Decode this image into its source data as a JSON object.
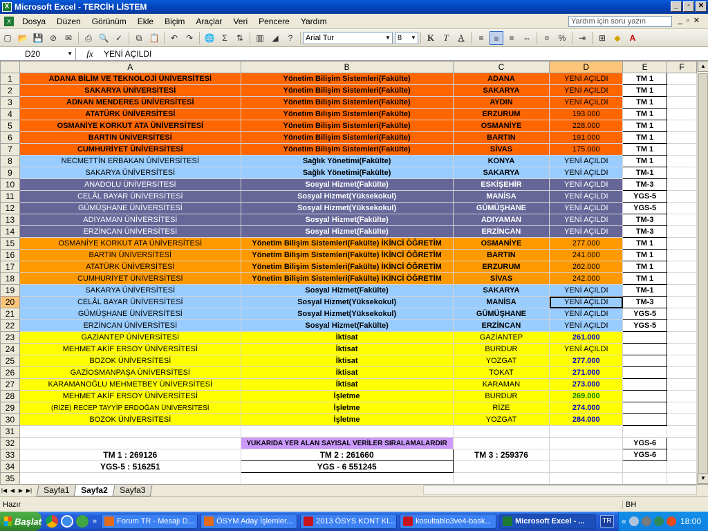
{
  "window": {
    "title": "Microsoft Excel - TERCİH LİSTEM",
    "min": "_",
    "max": "▫",
    "close": "✕"
  },
  "menu": {
    "items": [
      "Dosya",
      "Düzen",
      "Görünüm",
      "Ekle",
      "Biçim",
      "Araçlar",
      "Veri",
      "Pencere",
      "Yardım"
    ],
    "help_placeholder": "Yardım için soru yazın"
  },
  "toolbar": {
    "font": "Arial Tur",
    "size": "8",
    "bold": "K",
    "italic": "T",
    "underline": "A",
    "sum": "Σ",
    "percent": "%"
  },
  "formula": {
    "cell": "D20",
    "fx": "fx",
    "value": "YENİ AÇILDI"
  },
  "columns": [
    "A",
    "B",
    "C",
    "D",
    "E",
    "F"
  ],
  "colors": {
    "orange_red": "#ff6600",
    "orange": "#ff9900",
    "light_blue": "#99ccff",
    "slate": "#666699",
    "yellow": "#ffff00",
    "lavender": "#cc99ff",
    "num_blue": "#0000cc",
    "num_green": "#008000"
  },
  "rows": [
    {
      "n": "1",
      "a": "ADANA BİLİM VE TEKNOLOJİ ÜNİVERSİTESİ",
      "b": "Yönetim Bilişim Sistemleri(Fakülte)",
      "c": "ADANA",
      "d": "YENİ AÇILDI",
      "e": "TM 1",
      "style": "orange_red"
    },
    {
      "n": "2",
      "a": "SAKARYA ÜNİVERSİTESİ",
      "b": "Yönetim Bilişim Sistemleri(Fakülte)",
      "c": "SAKARYA",
      "d": "YENİ AÇILDI",
      "e": "TM 1",
      "style": "orange_red"
    },
    {
      "n": "3",
      "a": "ADNAN MENDERES ÜNİVERSİTESİ",
      "b": "Yönetim Bilişim Sistemleri(Fakülte)",
      "c": "AYDIN",
      "d": "YENİ AÇILDI",
      "e": "TM 1",
      "style": "orange_red"
    },
    {
      "n": "4",
      "a": "ATATÜRK ÜNİVERSİTESİ",
      "b": "Yönetim Bilişim Sistemleri(Fakülte)",
      "c": "ERZURUM",
      "d": "193.000",
      "e": "TM 1",
      "style": "orange_red"
    },
    {
      "n": "5",
      "a": "OSMANİYE KORKUT ATA ÜNİVERSİTESİ",
      "b": "Yönetim Bilişim Sistemleri(Fakülte)",
      "c": "OSMANİYE",
      "d": "228.000",
      "e": "TM 1",
      "style": "orange_red"
    },
    {
      "n": "6",
      "a": "BARTIN ÜNİVERSİTESİ",
      "b": "Yönetim Bilişim Sistemleri(Fakülte)",
      "c": "BARTIN",
      "d": "191.000",
      "e": "TM 1",
      "style": "orange_red"
    },
    {
      "n": "7",
      "a": "CUMHURİYET ÜNİVERSİTESİ",
      "b": "Yönetim Bilişim Sistemleri(Fakülte)",
      "c": "SİVAS",
      "d": "175.000",
      "e": "TM 1",
      "style": "orange_red"
    },
    {
      "n": "8",
      "a": "NECMETTİN ERBAKAN ÜNİVERSİTESİ",
      "b": "Sağlık Yönetimi(Fakülte)",
      "c": "KONYA",
      "d": "YENİ AÇILDI",
      "e": "TM 1",
      "style": "light_blue"
    },
    {
      "n": "9",
      "a": "SAKARYA ÜNİVERSİTESİ",
      "b": "Sağlık Yönetimi(Fakülte)",
      "c": "SAKARYA",
      "d": "YENİ AÇILDI",
      "e": "TM-1",
      "style": "light_blue"
    },
    {
      "n": "10",
      "a": "ANADOLU ÜNİVERSİTESİ",
      "b": "Sosyal Hizmet(Fakülte)",
      "c": "ESKİŞEHİR",
      "d": "YENİ AÇILDI",
      "e": "TM-3",
      "style": "slate"
    },
    {
      "n": "11",
      "a": "CELÂL BAYAR ÜNİVERSİTESİ",
      "b": "Sosyal Hizmet(Yüksekokul)",
      "c": "MANİSA",
      "d": "YENİ AÇILDI",
      "e": "YGS-5",
      "style": "slate"
    },
    {
      "n": "12",
      "a": "GÜMÜŞHANE ÜNİVERSİTESİ",
      "b": "Sosyal Hizmet(Yüksekokul)",
      "c": "GÜMÜŞHANE",
      "d": "YENİ AÇILDI",
      "e": "YGS-5",
      "style": "slate"
    },
    {
      "n": "13",
      "a": "ADIYAMAN ÜNİVERSİTESİ",
      "b": "Sosyal Hizmet(Fakülte)",
      "c": "ADIYAMAN",
      "d": "YENİ AÇILDI",
      "e": "TM-3",
      "style": "slate"
    },
    {
      "n": "14",
      "a": "ERZİNCAN ÜNİVERSİTESİ",
      "b": "Sosyal Hizmet(Fakülte)",
      "c": "ERZİNCAN",
      "d": "YENİ AÇILDI",
      "e": "TM-3",
      "style": "slate"
    },
    {
      "n": "15",
      "a": "OSMANİYE KORKUT ATA ÜNİVERSİTESİ",
      "b": "Yönetim Bilişim Sistemleri(Fakülte) İKİNCİ ÖĞRETİM",
      "c": "OSMANİYE",
      "d": "277.000",
      "e": "TM 1",
      "style": "orange"
    },
    {
      "n": "16",
      "a": "BARTIN ÜNİVERSİTESİ",
      "b": "Yönetim Bilişim Sistemleri(Fakülte) İKİNCİ ÖĞRETİM",
      "c": "BARTIN",
      "d": "241.000",
      "e": "TM 1",
      "style": "orange"
    },
    {
      "n": "17",
      "a": "ATATÜRK ÜNİVERSİTESİ",
      "b": "Yönetim Bilişim Sistemleri(Fakülte) İKİNCİ ÖĞRETİM",
      "c": "ERZURUM",
      "d": "262.000",
      "e": "TM 1",
      "style": "orange"
    },
    {
      "n": "18",
      "a": "CUMHURİYET ÜNİVERSİTESİ",
      "b": "Yönetim Bilişim Sistemleri(Fakülte) İKİNCİ ÖĞRETİM",
      "c": "SİVAS",
      "d": "242.000",
      "e": "TM 1",
      "style": "orange"
    },
    {
      "n": "19",
      "a": "SAKARYA ÜNİVERSİTESİ",
      "b": "Sosyal Hizmet(Fakülte)",
      "c": "SAKARYA",
      "d": "YENİ AÇILDI",
      "e": "TM-1",
      "style": "light_blue"
    },
    {
      "n": "20",
      "a": "CELÂL BAYAR ÜNİVERSİTESİ",
      "b": "Sosyal Hizmet(Yüksekokul)",
      "c": "MANİSA",
      "d": "YENİ AÇILDI",
      "e": "TM-3",
      "style": "light_blue"
    },
    {
      "n": "21",
      "a": "GÜMÜŞHANE ÜNİVERSİTESİ",
      "b": "Sosyal Hizmet(Yüksekokul)",
      "c": "GÜMÜŞHANE",
      "d": "YENİ AÇILDI",
      "e": "YGS-5",
      "style": "light_blue"
    },
    {
      "n": "22",
      "a": "ERZİNCAN ÜNİVERSİTESİ",
      "b": "Sosyal Hizmet(Fakülte)",
      "c": "ERZİNCAN",
      "d": "YENİ AÇILDI",
      "e": "YGS-5",
      "style": "light_blue"
    },
    {
      "n": "23",
      "a": "GAZİANTEP ÜNİVERSİTESİ",
      "b": "İktisat",
      "c": "GAZİANTEP",
      "d": "261.000",
      "e": "",
      "style": "yellow",
      "dnum": "blue"
    },
    {
      "n": "24",
      "a": "MEHMET AKİF ERSOY ÜNİVERSİTESİ",
      "b": "İktisat",
      "c": "BURDUR",
      "d": "YENİ AÇILDI",
      "e": "",
      "style": "yellow"
    },
    {
      "n": "25",
      "a": "BOZOK ÜNİVERSİTESİ",
      "b": "İktisat",
      "c": "YOZGAT",
      "d": "277.000",
      "e": "",
      "style": "yellow",
      "dnum": "blue"
    },
    {
      "n": "26",
      "a": "GAZİOSMANPAŞA ÜNİVERSİTESİ",
      "b": "İktisat",
      "c": "TOKAT",
      "d": "271.000",
      "e": "",
      "style": "yellow",
      "dnum": "blue"
    },
    {
      "n": "27",
      "a": "KARAMANOĞLU MEHMETBEY ÜNİVERSİTESİ",
      "b": "İktisat",
      "c": "KARAMAN",
      "d": "273.000",
      "e": "",
      "style": "yellow",
      "dnum": "blue"
    },
    {
      "n": "28",
      "a": "MEHMET AKİF ERSOY ÜNİVERSİTESİ",
      "b": "İşletme",
      "c": "BURDUR",
      "d": "269.000",
      "e": "",
      "style": "yellow",
      "dnum": "green"
    },
    {
      "n": "29",
      "a": "(RİZE) RECEP TAYYİP ERDOĞAN ÜNİVERSİTESİ",
      "b": "İşletme",
      "c": "RİZE",
      "d": "274.000",
      "e": "",
      "style": "yellow",
      "dnum": "blue"
    },
    {
      "n": "30",
      "a": "BOZOK ÜNİVERSİTESİ",
      "b": "İşletme",
      "c": "YOZGAT",
      "d": "284.000",
      "e": "",
      "style": "yellow",
      "dnum": "blue"
    }
  ],
  "footer": {
    "r31": "31",
    "r32": "32",
    "note": "YUKARIDA YER ALAN SAYISAL VERİLER SIRALAMALARDIR",
    "e32": "YGS-6",
    "r33": "33",
    "tm1": "TM 1 : 269126",
    "tm2": "TM 2 : 261660",
    "tm3": "TM 3 : 259376",
    "e33": "YGS-6",
    "r34": "34",
    "ygs5": "YGS-5 : 516251",
    "ygs6": "YGS - 6 551245",
    "r35": "35"
  },
  "sheets": [
    "Sayfa1",
    "Sayfa2",
    "Sayfa3"
  ],
  "status": {
    "ready": "Hazır",
    "mode": "BH"
  },
  "taskbar": {
    "start": "Başlat",
    "tasks": [
      "Forum TR - Mesajı D...",
      "ÖSYM Aday İşlemler...",
      "2013 ÖSYS KONT KI...",
      "kosultablo3ve4-bask...",
      "Microsoft Excel - ..."
    ],
    "lang": "TR",
    "clock": "18:00"
  }
}
